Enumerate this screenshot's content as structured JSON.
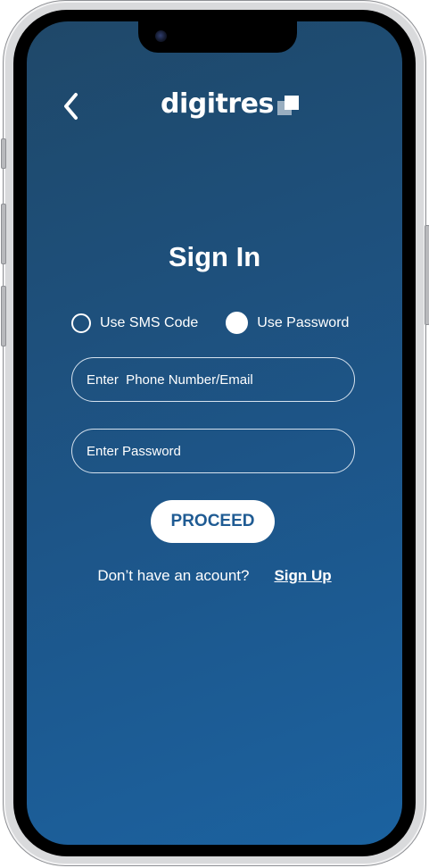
{
  "header": {
    "back_icon": "chevron-left-icon",
    "logo_text": "digitres",
    "logo_icon": "stacked-squares-icon"
  },
  "title": "Sign In",
  "login_method": {
    "options": [
      {
        "label": "Use SMS Code",
        "selected": false
      },
      {
        "label": "Use Password",
        "selected": true
      }
    ]
  },
  "form": {
    "identifier_placeholder": "Enter  Phone Number/Email",
    "identifier_value": "",
    "password_placeholder": "Enter Password",
    "password_value": ""
  },
  "proceed_label": "PROCEED",
  "signup": {
    "question": "Don’t have an acount?",
    "link_label": "Sign Up"
  },
  "colors": {
    "background_top": "#1f4869",
    "background_bottom": "#1b62a0",
    "button_text": "#1f5b93",
    "foreground": "#ffffff"
  }
}
